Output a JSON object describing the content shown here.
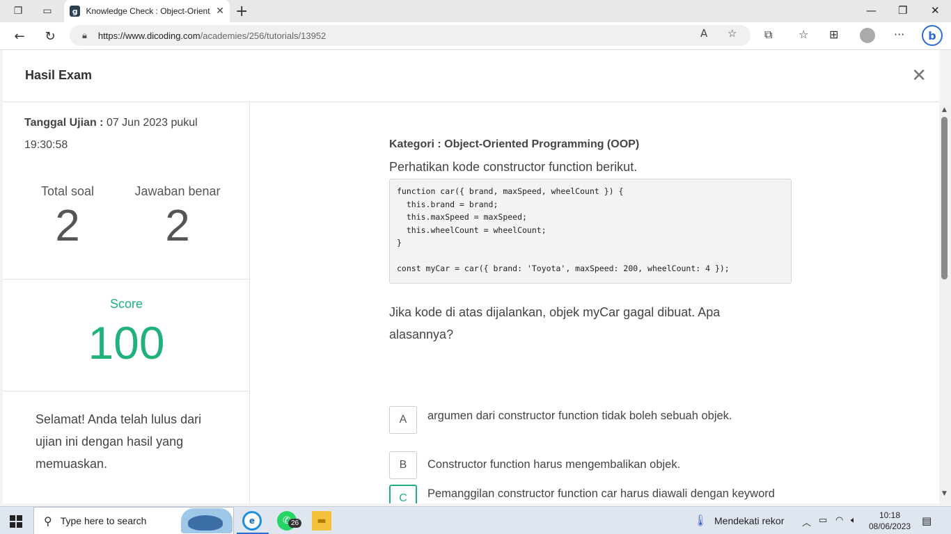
{
  "browser": {
    "tab_title": "Knowledge Check : Object-Oriented Programming",
    "url_domain": "https://www.dicoding.com",
    "url_path": "/academies/256/tutorials/13952",
    "icons": [
      "workspaces-icon",
      "tab-actions-icon",
      "back-icon",
      "refresh-icon",
      "lock-icon",
      "read-aloud-icon",
      "favorite-star-icon",
      "extensions-icon",
      "favorites-icon",
      "collections-icon",
      "profile-avatar",
      "more-menu-icon",
      "bing-copilot-icon"
    ]
  },
  "modal": {
    "title": "Hasil Exam",
    "close_glyph": "✕"
  },
  "summary": {
    "date_label": "Tanggal Ujian :",
    "date_value": "07 Jun 2023 pukul 19:30:58",
    "total_label": "Total soal",
    "total_value": "2",
    "correct_label": "Jawaban benar",
    "correct_value": "2",
    "score_label": "Score",
    "score_value": "100",
    "message": "Selamat! Anda telah lulus dari ujian ini dengan hasil yang memuaskan.",
    "score_color": "#21b17a"
  },
  "question": {
    "category": "Kategori : Object-Oriented Programming (OOP)",
    "intro": "Perhatikan kode constructor function berikut.",
    "code_lines": [
      "function car({ brand, maxSpeed, wheelCount }) {",
      "  this.brand = brand;",
      "  this.maxSpeed = maxSpeed;",
      "  this.wheelCount = wheelCount;",
      "}",
      "",
      "const myCar = car({ brand: 'Toyota', maxSpeed: 200, wheelCount: 4 });"
    ],
    "text": "Jika kode di atas dijalankan, objek myCar gagal dibuat. Apa alasannya?",
    "options": [
      {
        "letter": "A",
        "text": "argumen dari constructor function tidak boleh sebuah objek.",
        "correct": false
      },
      {
        "letter": "B",
        "text": "Constructor function harus mengembalikan objek.",
        "correct": false
      },
      {
        "letter": "C",
        "text": "Pemanggilan constructor function car harus diawali dengan keyword new.",
        "correct": true
      }
    ]
  },
  "taskbar": {
    "search_placeholder": "Type here to search",
    "whatsapp_badge": "26",
    "weather_text": "Mendekati rekor",
    "time": "10:18",
    "date": "08/06/2023"
  }
}
